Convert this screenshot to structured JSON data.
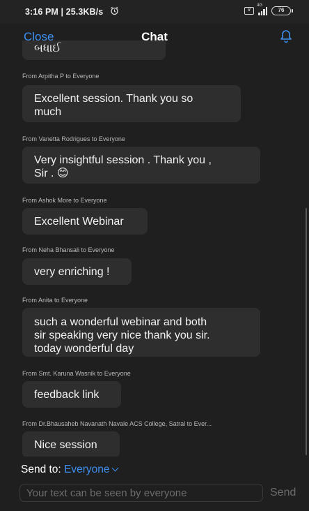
{
  "status_bar": {
    "time_speed": "3:16 PM | 25.3KB/s",
    "alarm_icon": "alarm-clock-icon",
    "network_type": "4G",
    "battery_level": "76"
  },
  "header": {
    "close_label": "Close",
    "title": "Chat",
    "bell_icon": "bell-icon"
  },
  "messages": [
    {
      "meta": "",
      "lines": [
        "બધાઈ"
      ]
    },
    {
      "meta": "From Arpitha P to Everyone",
      "lines": [
        "Excellent session. Thank you so",
        "much"
      ]
    },
    {
      "meta": "From Vanetta Rodrigues to Everyone",
      "lines": [
        "Very insightful session . Thank you ,",
        "Sir . 😊"
      ]
    },
    {
      "meta": "From Ashok More to Everyone",
      "lines": [
        "Excellent Webinar"
      ]
    },
    {
      "meta": "From Neha Bhansali to Everyone",
      "lines": [
        "very enriching !"
      ]
    },
    {
      "meta": "From Anita to Everyone",
      "lines": [
        "such a wonderful webinar and both",
        "sir speaking very nice thank you sir.",
        "today wonderful day"
      ]
    },
    {
      "meta": "From Smt. Karuna Wasnik to Everyone",
      "lines": [
        "feedback link"
      ]
    },
    {
      "meta": "From Dr.Bhausaheb Navanath Navale ACS College, Satral to Ever...",
      "lines": [
        "Nice session"
      ]
    }
  ],
  "composer": {
    "send_to_label": "Send to:",
    "send_to_value": "Everyone",
    "placeholder": "Your text can be seen by everyone",
    "send_label": "Send"
  },
  "colors": {
    "accent": "#3d8ff0",
    "background": "#1f1f1f",
    "bubble": "#2e2e2e"
  }
}
